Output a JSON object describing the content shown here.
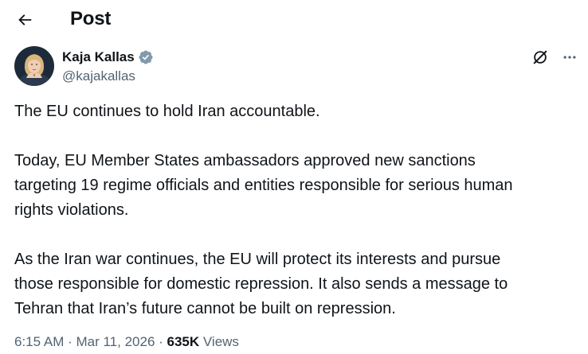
{
  "header": {
    "title": "Post",
    "back_icon": "arrow-left-icon"
  },
  "author": {
    "display_name": "Kaja Kallas",
    "handle": "@kajakallas",
    "verified_icon": "verified-badge-icon",
    "verified_color": "#829aab"
  },
  "actions": {
    "grok_icon": "grok-icon",
    "more_icon": "more-options-icon"
  },
  "tweet": {
    "paragraph_1": "The EU continues to hold Iran accountable.",
    "paragraph_2": "Today, EU Member States ambassadors approved new sanctions\ntargeting 19 regime officials and entities responsible for serious human\nrights violations.",
    "paragraph_3": "As the Iran war continues, the EU will protect its interests and pursue\nthose responsible for domestic repression. It also sends a message to\nTehran that Iran’s future cannot be built on repression."
  },
  "meta": {
    "time": "6:15 AM",
    "separator": " · ",
    "date": "Mar 11, 2026",
    "views_count": "635K",
    "views_label": " Views"
  },
  "colors": {
    "text": "#0f1419",
    "secondary": "#536471",
    "background": "#ffffff"
  }
}
